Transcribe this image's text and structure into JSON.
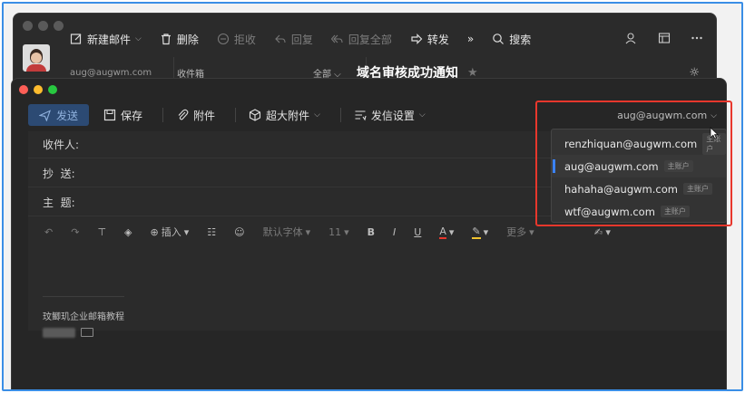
{
  "back_window": {
    "toolbar": {
      "new_mail": "新建邮件",
      "delete": "删除",
      "reject": "拒收",
      "reply": "回复",
      "reply_all": "回复全部",
      "forward": "转发",
      "more": "»",
      "search": "搜索"
    },
    "account": "aug@augwm.com",
    "folder": "收件箱",
    "filter": "全部",
    "subject": "域名审核成功通知"
  },
  "compose": {
    "toolbar": {
      "send": "发送",
      "save": "保存",
      "attach": "附件",
      "large_attach": "超大附件",
      "send_settings": "发信设置"
    },
    "sender": "aug@augwm.com",
    "fields": {
      "to_label": "收件人:",
      "cc_label": "抄  送:",
      "subject_label": "主  题:"
    },
    "format": {
      "insert": "插入",
      "font": "默认字体",
      "size": "11",
      "more": "更多"
    },
    "signature": "玟鲫玑企业邮箱教程"
  },
  "dropdown": {
    "options": [
      {
        "email": "renzhiquan@augwm.com",
        "tag": "主账户"
      },
      {
        "email": "aug@augwm.com",
        "tag": "主账户"
      },
      {
        "email": "hahaha@augwm.com",
        "tag": "主账户"
      },
      {
        "email": "wtf@augwm.com",
        "tag": "主账户"
      }
    ],
    "selected_index": 1
  },
  "colors": {
    "accent": "#3b82f6",
    "highlight": "#e8372c",
    "send_bg": "#2c4a73"
  }
}
